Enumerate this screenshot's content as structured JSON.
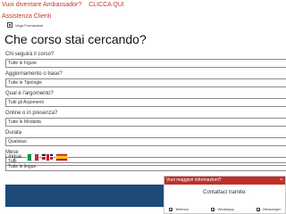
{
  "header": {
    "ambassador_text": "Vuoi diventare Ambassador?",
    "ambassador_cta": "CLICCA QUI",
    "assistenza": "Assistenza Clienti",
    "logo_text": "Vega Formazione"
  },
  "page_title": "Che corso stai cercando?",
  "form": {
    "fields": [
      {
        "label": "Chi seguirà il corso?",
        "value": "Tutte le Figure"
      },
      {
        "label": "Aggiornamento o base?",
        "value": "Tutte le Tipologie"
      },
      {
        "label": "Qual è l'argomento?",
        "value": "Tutti gli Argomenti"
      },
      {
        "label": "Online o in presenza?",
        "value": "Tutte le Modalità"
      },
      {
        "label": "Durata",
        "value": "Qualsiasi"
      },
      {
        "label": "Mese",
        "value": "Tutti"
      }
    ],
    "lingua_label": "Lingua",
    "lingue_value": "Tutte le lingue"
  },
  "chat": {
    "title": "Vuoi maggiori informazioni?",
    "close": "×",
    "contact_label": "Contattaci tramite:",
    "buttons": [
      "Telefono",
      "WhatsApp",
      "Messenger"
    ]
  },
  "colors": {
    "link_red": "#c0392b",
    "chat_header_red": "#c0302a",
    "banner_blue": "#1d4a78"
  }
}
